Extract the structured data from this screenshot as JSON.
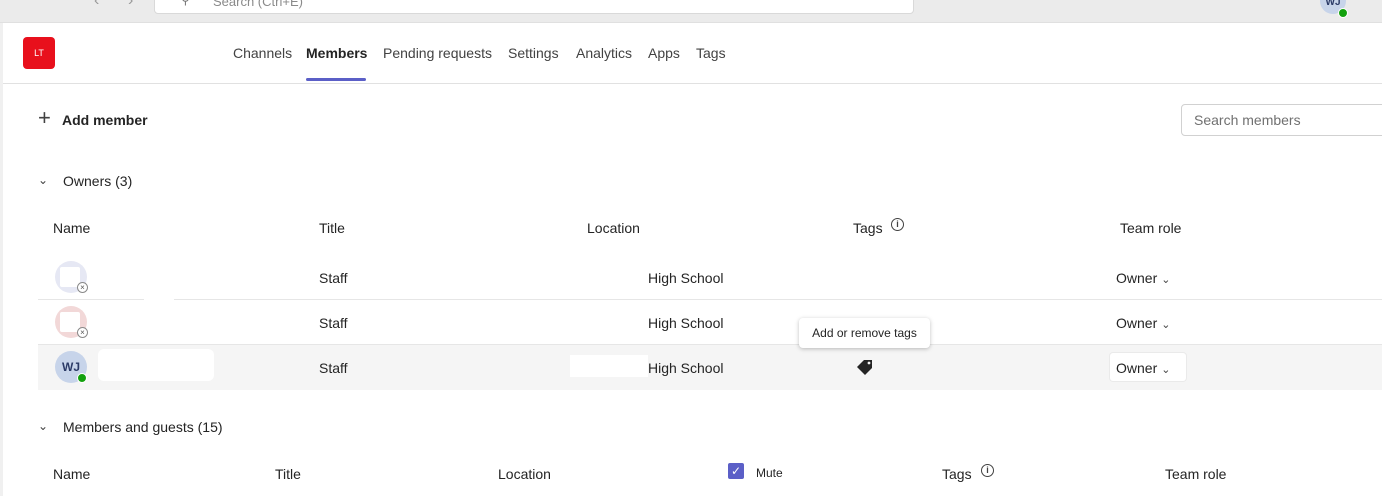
{
  "top_bar": {
    "back_icon": "chevron-left-icon",
    "forward_icon": "chevron-right-icon",
    "search_placeholder": "Search (Ctrl+E)",
    "more_icon": "more-horizontal-icon",
    "user_initials": "WJ",
    "presence": "available"
  },
  "team": {
    "tile_text": "LT",
    "tile_color": "#e8101c"
  },
  "tabs": [
    {
      "label": "Channels",
      "active": false
    },
    {
      "label": "Members",
      "active": true
    },
    {
      "label": "Pending requests",
      "active": false
    },
    {
      "label": "Settings",
      "active": false
    },
    {
      "label": "Analytics",
      "active": false
    },
    {
      "label": "Apps",
      "active": false
    },
    {
      "label": "Tags",
      "active": false
    }
  ],
  "toolbar": {
    "add_member_label": "Add member",
    "search_placeholder": "Search members"
  },
  "owners_section": {
    "title": "Owners (3)",
    "columns": {
      "name": "Name",
      "title": "Title",
      "location": "Location",
      "tags": "Tags",
      "team_role": "Team role"
    },
    "rows": [
      {
        "title": "Staff",
        "location": "High School",
        "role": "Owner"
      },
      {
        "title": "Staff",
        "location": "High School",
        "role": "Owner"
      },
      {
        "avatar_initials": "WJ",
        "title": "Staff",
        "location": "High School",
        "role": "Owner"
      }
    ],
    "tooltip": "Add or remove tags"
  },
  "members_section": {
    "title": "Members and guests (15)",
    "columns": {
      "name": "Name",
      "title": "Title",
      "location": "Location",
      "mute": "Mute",
      "tags": "Tags",
      "team_role": "Team role"
    },
    "mute_checked": true
  },
  "colors": {
    "accent": "#5b5fc7",
    "presence_available": "#13a10e"
  }
}
